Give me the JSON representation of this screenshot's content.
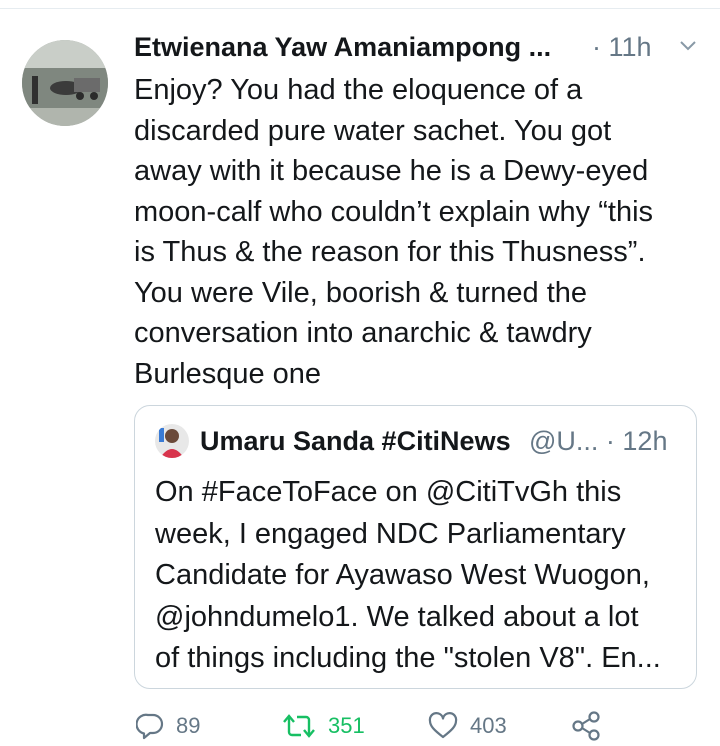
{
  "tweet": {
    "author_name": "Etwienana Yaw Amaniampong ...",
    "time": "· 11h",
    "avatar_icon": "user-avatar-photo",
    "text": "Enjoy? You had the eloquence of a\ndiscarded pure water sachet. You got\naway with it because he is a Dewy-eyed\nmoon-calf who couldn’t explain why “this\nis Thus & the reason for this Thusness”.\nYou were Vile, boorish & turned the\nconversation into anarchic & tawdry\nBurlesque one"
  },
  "quote": {
    "author_name": "Umaru Sanda #CitiNews",
    "handle_time": "@U... · 12h",
    "avatar_icon": "quoted-user-avatar",
    "text": "On #FaceToFace on @CitiTvGh this\nweek, I engaged NDC Parliamentary\nCandidate for Ayawaso West Wuogon,\n@johndumelo1. We talked about a lot\nof things including the \"stolen V8\". En..."
  },
  "actions": {
    "replies": "89",
    "retweets": "351",
    "likes": "403"
  },
  "colors": {
    "secondary_text": "#657786",
    "retweet_green": "#17bf63",
    "border": "#ccd6dd"
  }
}
